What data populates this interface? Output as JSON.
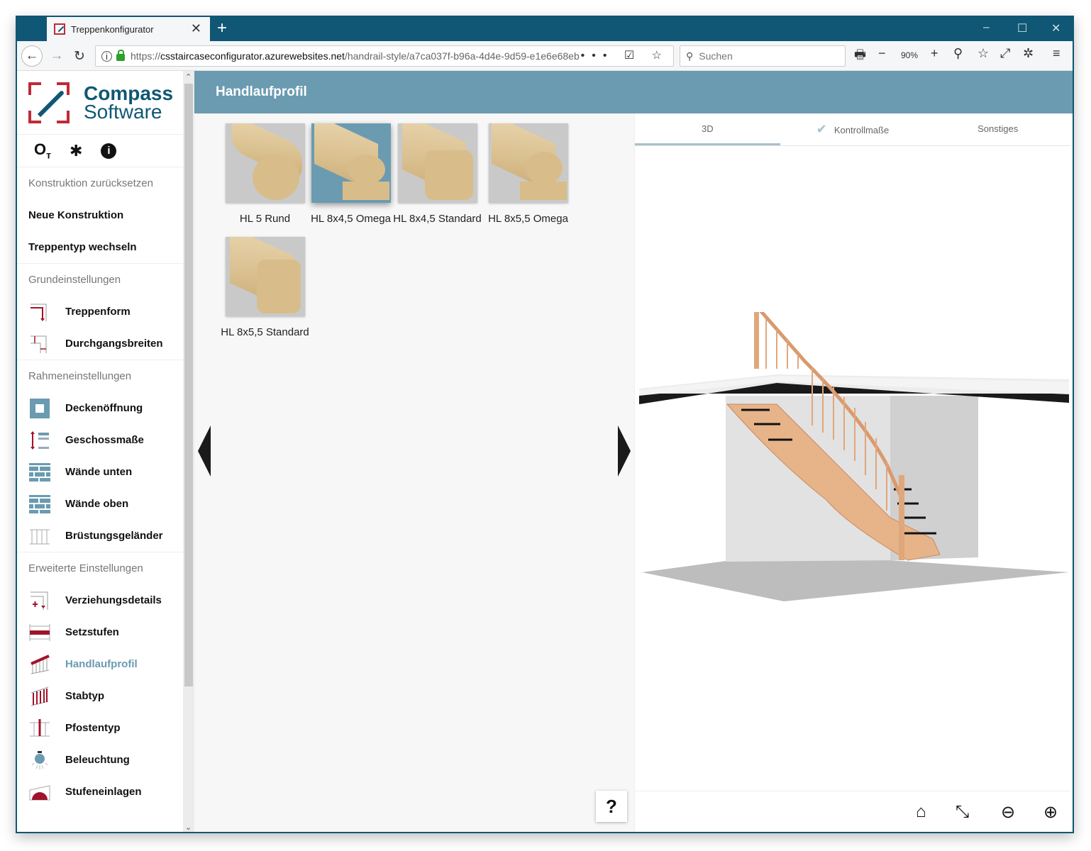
{
  "browser": {
    "tab_title": "Treppenkonfigurator",
    "new_tab": "+",
    "url_scheme": "https://",
    "url_host": "csstaircaseconfigurator.azurewebsites.net",
    "url_path": "/handrail-style/a7ca037f-b96a-4d4e-9d59-e1e6e68eb",
    "url_actions": "••• ☑ ☆",
    "search_placeholder": "Suchen",
    "zoom_level": "90%",
    "window_controls": {
      "minimize": "–",
      "maximize": "☐",
      "close": "✕"
    }
  },
  "sidebar": {
    "logo": {
      "line1": "Compass",
      "line2": "Software"
    },
    "top_icons": [
      "key-icon",
      "gear-icon",
      "info-icon"
    ],
    "sections": [
      {
        "header": "Konstruktion zurücksetzen",
        "items": [
          {
            "label": "Neue Konstruktion",
            "icon": ""
          },
          {
            "label": "Treppentyp wechseln",
            "icon": ""
          }
        ]
      },
      {
        "header": "Grundeinstellungen",
        "items": [
          {
            "label": "Treppenform",
            "icon": "stair-shape-icon"
          },
          {
            "label": "Durchgangsbreiten",
            "icon": "passage-width-icon"
          }
        ]
      },
      {
        "header": "Rahmeneinstellungen",
        "items": [
          {
            "label": "Deckenöffnung",
            "icon": "ceiling-opening-icon"
          },
          {
            "label": "Geschossmaße",
            "icon": "floor-height-icon"
          },
          {
            "label": "Wände unten",
            "icon": "wall-icon"
          },
          {
            "label": "Wände oben",
            "icon": "wall-icon"
          },
          {
            "label": "Brüstungsgeländer",
            "icon": "balustrade-icon"
          }
        ]
      },
      {
        "header": "Erweiterte Einstellungen",
        "items": [
          {
            "label": "Verziehungsdetails",
            "icon": "winder-details-icon"
          },
          {
            "label": "Setzstufen",
            "icon": "riser-icon"
          },
          {
            "label": "Handlaufprofil",
            "icon": "handrail-icon",
            "active": true
          },
          {
            "label": "Stabtyp",
            "icon": "baluster-icon"
          },
          {
            "label": "Pfostentyp",
            "icon": "post-icon"
          },
          {
            "label": "Beleuchtung",
            "icon": "light-icon"
          },
          {
            "label": "Stufeneinlagen",
            "icon": "tread-inlay-icon"
          }
        ]
      }
    ]
  },
  "main": {
    "title": "Handlaufprofil",
    "profiles": [
      {
        "label": "HL 5 Rund",
        "shape": "round",
        "selected": false
      },
      {
        "label": "HL 8x4,5 Omega",
        "shape": "omega",
        "selected": true
      },
      {
        "label": "HL 8x4,5 Standard",
        "shape": "standard",
        "selected": false
      },
      {
        "label": "HL 8x5,5 Omega",
        "shape": "omega",
        "selected": false
      },
      {
        "label": "HL 8x5,5 Standard",
        "shape": "standard",
        "selected": false
      }
    ],
    "help_label": "?"
  },
  "viewer": {
    "tabs": [
      {
        "label": "3D",
        "active": true
      },
      {
        "label": "Kontrollmaße",
        "check": true
      },
      {
        "label": "Sonstiges"
      }
    ],
    "controls": [
      "home-icon",
      "fullscreen-icon",
      "zoom-out-icon",
      "zoom-in-icon"
    ]
  },
  "colors": {
    "accent": "#6a9bb1",
    "brand_blue": "#0f5774",
    "brand_red": "#c02a35"
  }
}
